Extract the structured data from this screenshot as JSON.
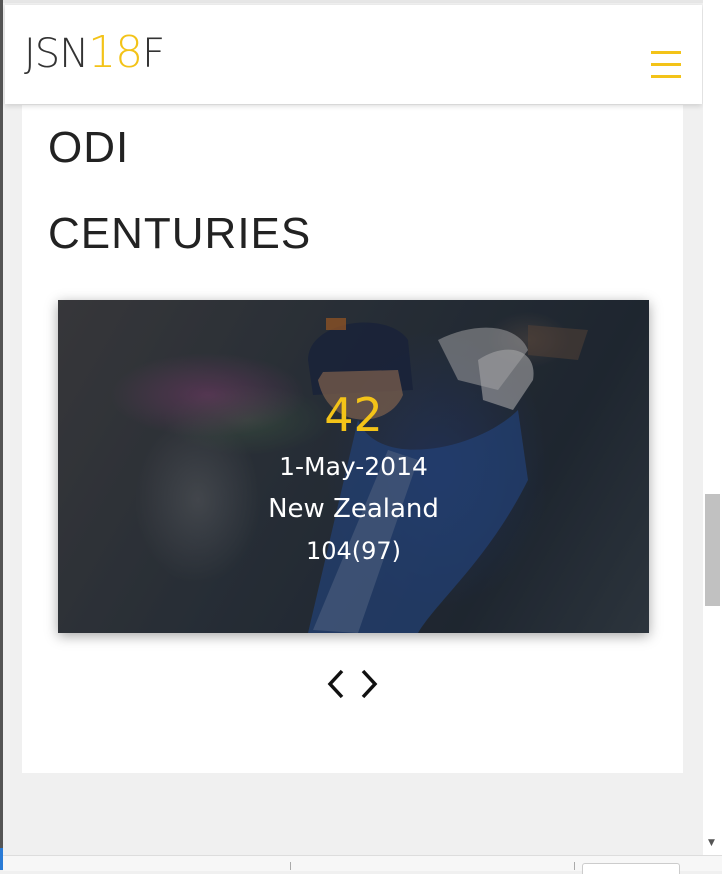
{
  "header": {
    "logo_prefix": "JSN",
    "logo_accent": "18",
    "logo_suffix": "F",
    "menu_icon": "hamburger-menu-icon"
  },
  "section": {
    "title_line1": "ODI",
    "title_line2": "CENTURIES"
  },
  "slide": {
    "number": "42",
    "date": "1-May-2014",
    "opponent": "New Zealand",
    "score": "104(97)"
  },
  "carousel": {
    "prev_icon": "chevron-left-icon",
    "next_icon": "chevron-right-icon"
  },
  "colors": {
    "accent": "#f3c318",
    "text_dark": "#222222",
    "card_bg": "#ffffff",
    "page_bg": "#f0f0f0"
  }
}
